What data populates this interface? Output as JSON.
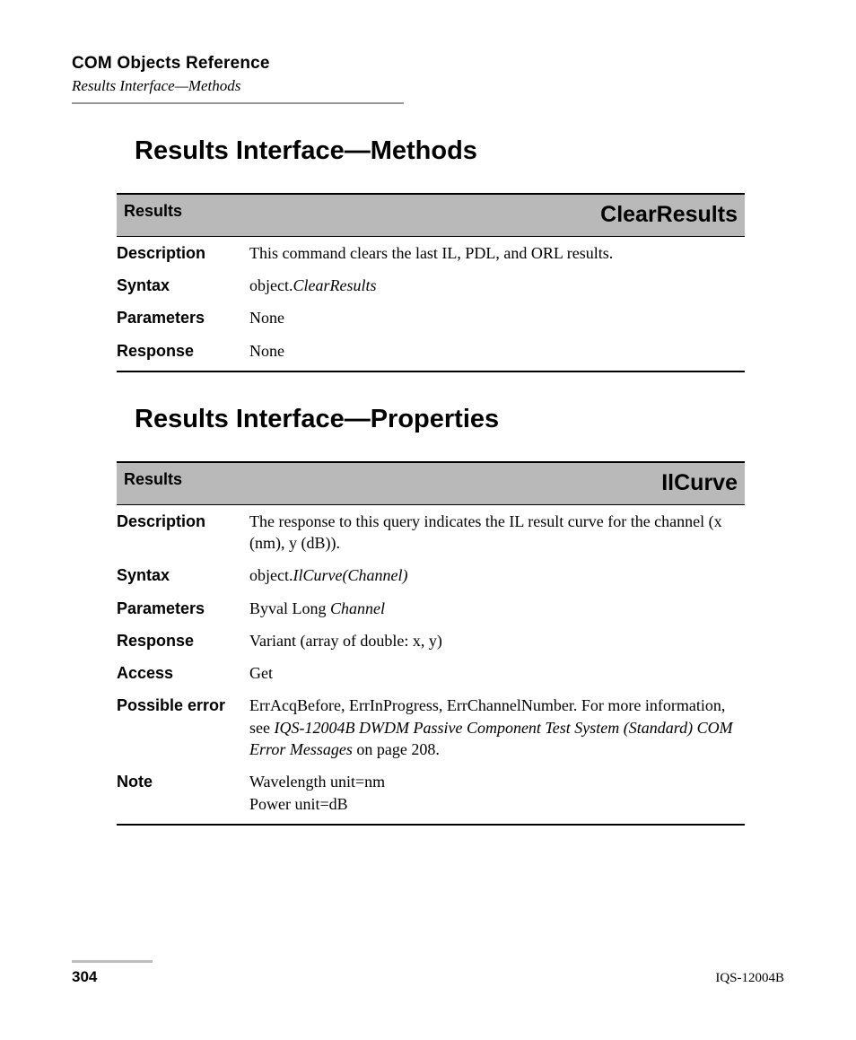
{
  "running_head": {
    "title": "COM Objects Reference",
    "subtitle": "Results Interface—Methods"
  },
  "section1": {
    "title": "Results Interface—Methods",
    "header_left": "Results",
    "header_right": "ClearResults",
    "rows": {
      "description_label": "Description",
      "description_value": "This command clears the last IL, PDL, and ORL results.",
      "syntax_label": "Syntax",
      "syntax_prefix": "object.",
      "syntax_method": "ClearResults",
      "parameters_label": "Parameters",
      "parameters_value": "None",
      "response_label": "Response",
      "response_value": "None"
    }
  },
  "section2": {
    "title": "Results Interface—Properties",
    "header_left": "Results",
    "header_right": "IlCurve",
    "rows": {
      "description_label": "Description",
      "description_value": "The response to this query indicates the IL result curve for the channel (x (nm), y (dB)).",
      "syntax_label": "Syntax",
      "syntax_prefix": "object.",
      "syntax_method": "IlCurve(Channel)",
      "parameters_label": "Parameters",
      "parameters_prefix": "Byval Long ",
      "parameters_italic": "Channel",
      "response_label": "Response",
      "response_value": "Variant (array of double: x, y)",
      "access_label": "Access",
      "access_value": "Get",
      "possible_error_label": "Possible error",
      "possible_error_pre": "ErrAcqBefore, ErrInProgress, ErrChannelNumber. For more information, see ",
      "possible_error_italic": "IQS-12004B DWDM Passive Component Test System (Standard) COM Error Messages",
      "possible_error_post": " on page 208.",
      "note_label": "Note",
      "note_line1": "Wavelength unit=nm",
      "note_line2": "Power unit=dB"
    }
  },
  "footer": {
    "page": "304",
    "code": "IQS-12004B"
  }
}
